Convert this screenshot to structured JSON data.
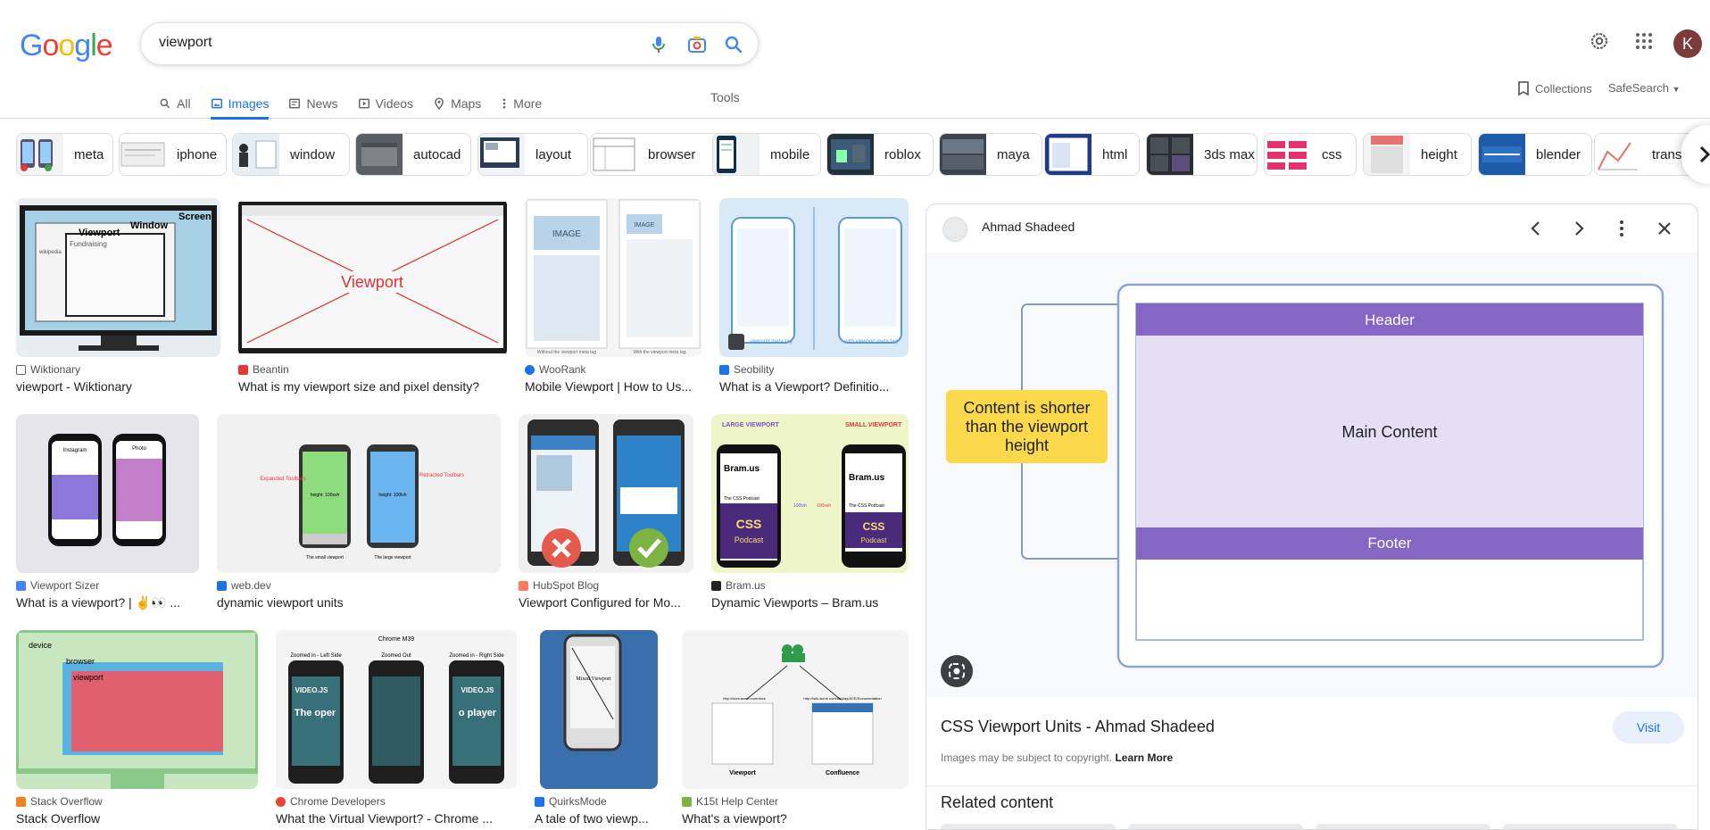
{
  "logo": [
    "G",
    "o",
    "o",
    "g",
    "l",
    "e"
  ],
  "search": {
    "value": "viewport"
  },
  "user": {
    "initial": "K"
  },
  "tabs": [
    {
      "label": "All",
      "icon": "search-icon"
    },
    {
      "label": "Images",
      "icon": "image-icon",
      "active": true
    },
    {
      "label": "News",
      "icon": "news-icon"
    },
    {
      "label": "Videos",
      "icon": "play-icon"
    },
    {
      "label": "Maps",
      "icon": "pin-icon"
    },
    {
      "label": "More",
      "icon": "dots-vertical-icon"
    }
  ],
  "tools_label": "Tools",
  "collections_label": "Collections",
  "safesearch_label": "SafeSearch",
  "chips": [
    "meta",
    "iphone",
    "window",
    "autocad",
    "layout",
    "browser",
    "mobile",
    "roblox",
    "maya",
    "html",
    "3ds max",
    "css",
    "height",
    "blender",
    "transf"
  ],
  "results": [
    {
      "source": "Wiktionary",
      "title": "viewport - Wiktionary"
    },
    {
      "source": "Beantin",
      "title": "What is my viewport size and pixel density?"
    },
    {
      "source": "WooRank",
      "title": "Mobile Viewport | How to Us..."
    },
    {
      "source": "Seobility",
      "title": "What is a Viewport? Definitio..."
    },
    {
      "source": "Viewport Sizer",
      "title": "What is a viewport? | ✌️👀 ..."
    },
    {
      "source": "web.dev",
      "title": "dynamic viewport units"
    },
    {
      "source": "HubSpot Blog",
      "title": "Viewport Configured for Mo..."
    },
    {
      "source": "Bram.us",
      "title": "Dynamic Viewports – Bram.us"
    },
    {
      "source": "Stack Overflow",
      "title": "Stack Overflow"
    },
    {
      "source": "Chrome Developers",
      "title": "What the Virtual Viewport? - Chrome ..."
    },
    {
      "source": "QuirksMode",
      "title": "A tale of two viewp..."
    },
    {
      "source": "K15t Help Center",
      "title": "What's a viewport?"
    }
  ],
  "image_text": {
    "r1c1_screen": "Screen",
    "r1c1_window": "Window",
    "r1c1_viewport": "Viewport",
    "r1c1_fund": "Fundraising",
    "r1c1_wiki": "wikipedia",
    "r1c2_viewport": "Viewport",
    "r1c3_image": "IMAGE",
    "r1c3_image2": "IMAGE",
    "r1c3_cap1": "Without the viewport meta tag",
    "r1c3_cap2": "With the viewport meta tag",
    "r1c4_cap1": "viewport meta tag",
    "r1c4_cap2": "with viewport meta tag",
    "r2c1_photo": "Photo",
    "r2c1_instagram": "Instagram",
    "r2c2_left": "Expanded Toolbars",
    "r2c2_right": "Retracted Toolbars",
    "r2c2_h1": "height: 100svh",
    "r2c2_h2": "height: 100lvh",
    "r2c2_cap1": "The small viewport",
    "r2c2_cap2": "The large viewport",
    "r2c4_large": "LARGE VIEWPORT",
    "r2c4_small": "SMALL VIEWPORT",
    "r2c4_bram": "Bram.us",
    "r2c4_pod": "The CSS Podcast",
    "r2c4_css": "CSS",
    "r2c4_podcast": "Podcast",
    "r2c4_100lvh": "100lvh",
    "r2c4_100svh": "100svh",
    "r3c1_device": "device",
    "r3c1_browser": "browser",
    "r3c1_viewport": "viewport",
    "r3c2_m39": "Chrome M39",
    "r3c2_zl": "Zoomed in - Left Side",
    "r3c2_zo": "Zoomed Out",
    "r3c2_zr": "Zoomed in - Right Side",
    "r3c2_video": "VIDEO.JS",
    "r3c2_open": "The oper",
    "r3c2_player": "o player",
    "r3c3_title": "Mixed Viewport",
    "r3c4_url1": "http://docs.acme.com/docs",
    "r3c4_url2": "http://wiki.acme.com/display/ACE/Documentation",
    "r3c4_viewport": "Viewport",
    "r3c4_confluence": "Confluence"
  },
  "panel": {
    "source": "Ahmad Shadeed",
    "diagram": {
      "header": "Header",
      "main": "Main Content",
      "footer": "Footer",
      "note": "Content is shorter than the viewport height"
    },
    "title": "CSS Viewport Units - Ahmad Shadeed",
    "visit": "Visit",
    "copyright": "Images may be subject to copyright.",
    "learn_more": "Learn More",
    "related": "Related content"
  }
}
